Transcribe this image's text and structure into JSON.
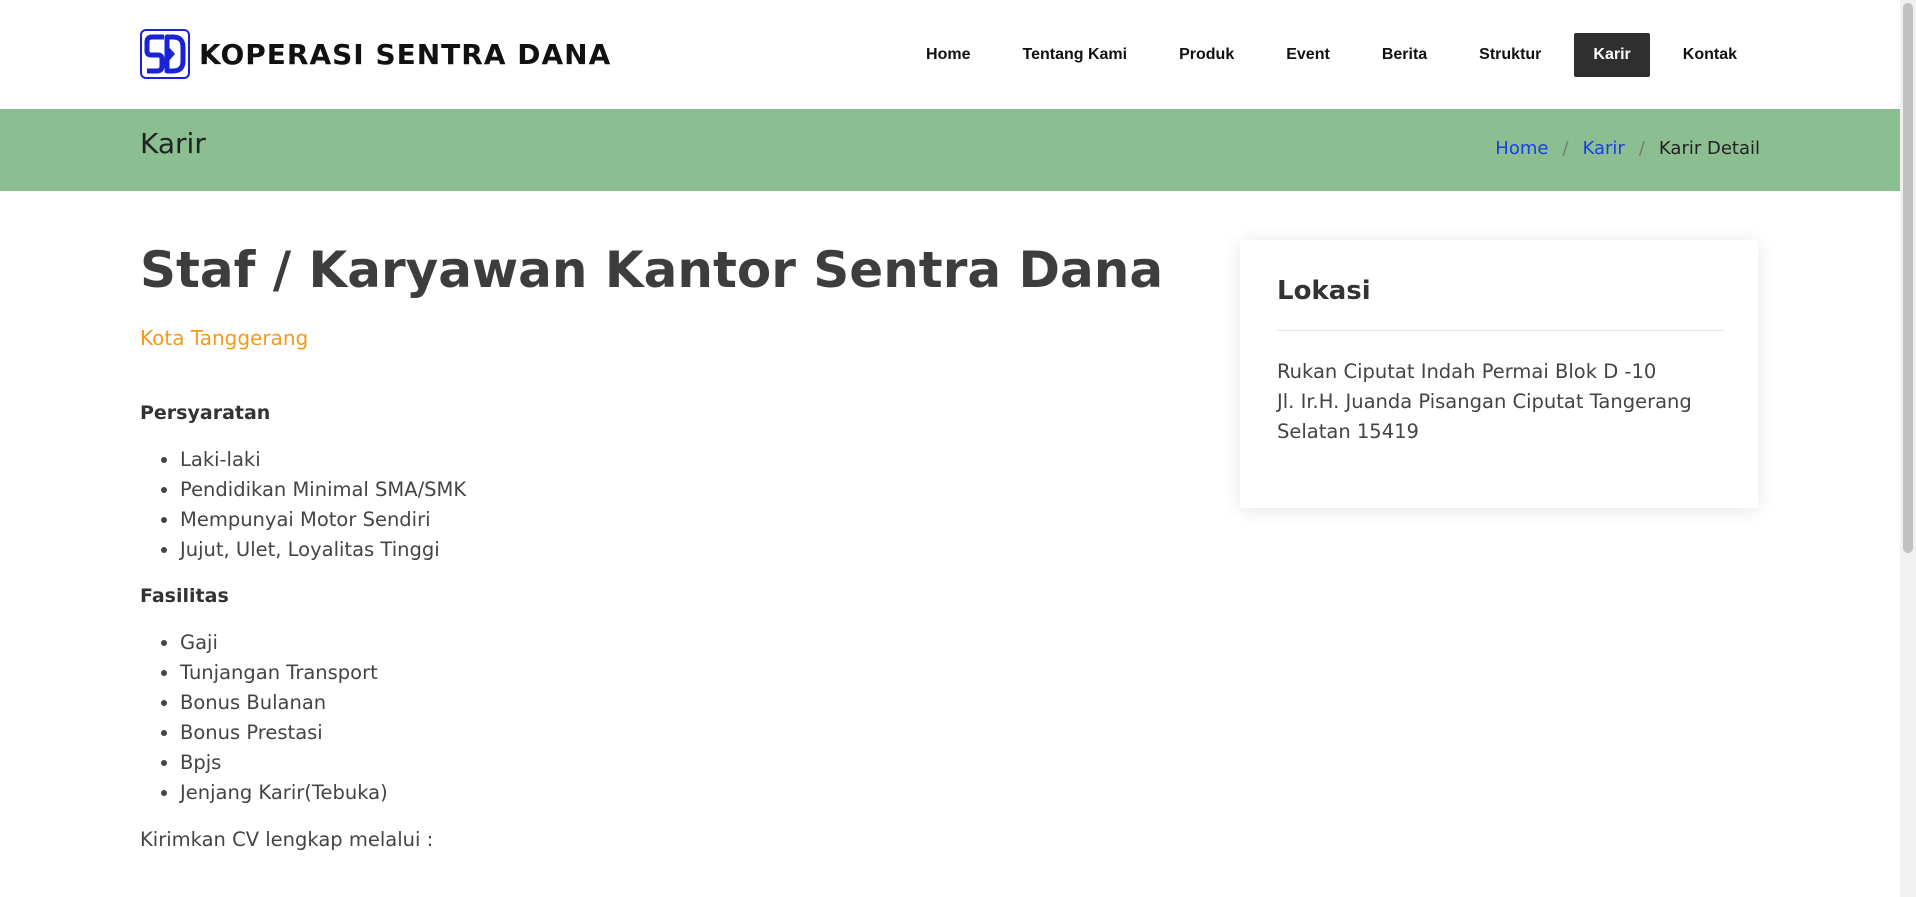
{
  "brand": {
    "name": "KOPERASI SENTRA DANA",
    "logo_letters": "SD",
    "logo_color": "#1a22d6"
  },
  "nav": {
    "items": [
      {
        "label": "Home"
      },
      {
        "label": "Tentang Kami"
      },
      {
        "label": "Produk"
      },
      {
        "label": "Event"
      },
      {
        "label": "Berita"
      },
      {
        "label": "Struktur"
      },
      {
        "label": "Karir",
        "active": true
      },
      {
        "label": "Kontak"
      }
    ]
  },
  "banner": {
    "title": "Karir",
    "breadcrumb": [
      {
        "label": "Home"
      },
      {
        "label": "Karir"
      },
      {
        "label": "Karir Detail"
      }
    ],
    "separator": "/",
    "color": "#8bbe90"
  },
  "job": {
    "title": "Staf / Karyawan Kantor Sentra Dana",
    "location": "Kota Tanggerang",
    "requirements_heading": "Persyaratan",
    "requirements": [
      "Laki-laki",
      "Pendidikan Minimal SMA/SMK",
      "Mempunyai Motor Sendiri",
      "Jujut, Ulet, Loyalitas Tinggi"
    ],
    "facilities_heading": "Fasilitas",
    "facilities": [
      "Gaji",
      "Tunjangan Transport",
      "Bonus Bulanan",
      "Bonus Prestasi",
      "Bpjs",
      "Jenjang Karir(Tebuka)"
    ],
    "cta": "Kirimkan CV lengkap melalui :"
  },
  "location_card": {
    "title": "Lokasi",
    "address_lines": [
      "Rukan Ciputat Indah Permai Blok D -10",
      "Jl. Ir.H. Juanda Pisangan Ciputat Tangerang",
      "Selatan 15419"
    ]
  },
  "colors": {
    "accent_orange": "#f29a1d",
    "link_blue": "#1a3fe0",
    "active_nav_bg": "#2f2f2f"
  }
}
